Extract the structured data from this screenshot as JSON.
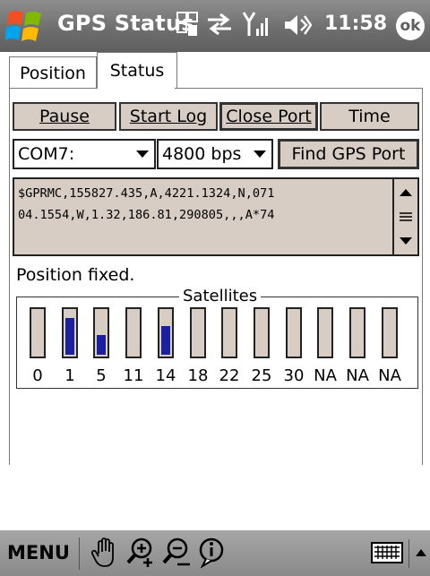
{
  "title_bar": {
    "app_title": "GPS Status",
    "time": "11:58",
    "ok_label": "ok"
  },
  "tabs": [
    {
      "label": "Position",
      "active": false
    },
    {
      "label": "Status",
      "active": true
    }
  ],
  "buttons": {
    "pause": "Pause",
    "start_log": "Start Log",
    "close_port": "Close Port",
    "time": "Time",
    "find_gps_port": "Find GPS Port"
  },
  "port": {
    "com_value": "COM7:",
    "baud_value": "4800 bps"
  },
  "nmea_lines": [
    "$GPRMC,155827.435,A,4221.1324,N,071",
    "04.1554,W,1.32,186.81,290805,,,A*74"
  ],
  "status_text": "Position fixed.",
  "satellites": {
    "legend": "Satellites",
    "items": [
      {
        "prn": "0",
        "signal": 0
      },
      {
        "prn": "1",
        "signal": 0.83
      },
      {
        "prn": "5",
        "signal": 0.45
      },
      {
        "prn": "11",
        "signal": 0
      },
      {
        "prn": "14",
        "signal": 0.66
      },
      {
        "prn": "18",
        "signal": 0
      },
      {
        "prn": "22",
        "signal": 0
      },
      {
        "prn": "25",
        "signal": 0
      },
      {
        "prn": "30",
        "signal": 0
      },
      {
        "prn": "NA",
        "signal": 0
      },
      {
        "prn": "NA",
        "signal": 0
      },
      {
        "prn": "NA",
        "signal": 0
      }
    ]
  },
  "menu_bar": {
    "menu_label": "MENU",
    "icons": [
      "hand-icon",
      "zoom-in-icon",
      "zoom-out-icon",
      "info-icon",
      "keyboard-icon",
      "input-arrow-icon"
    ]
  },
  "colors": {
    "signal_fill": "#1b1fa0",
    "button_bg": "#d7cdc5",
    "title_bar": "#6f6f6f"
  }
}
